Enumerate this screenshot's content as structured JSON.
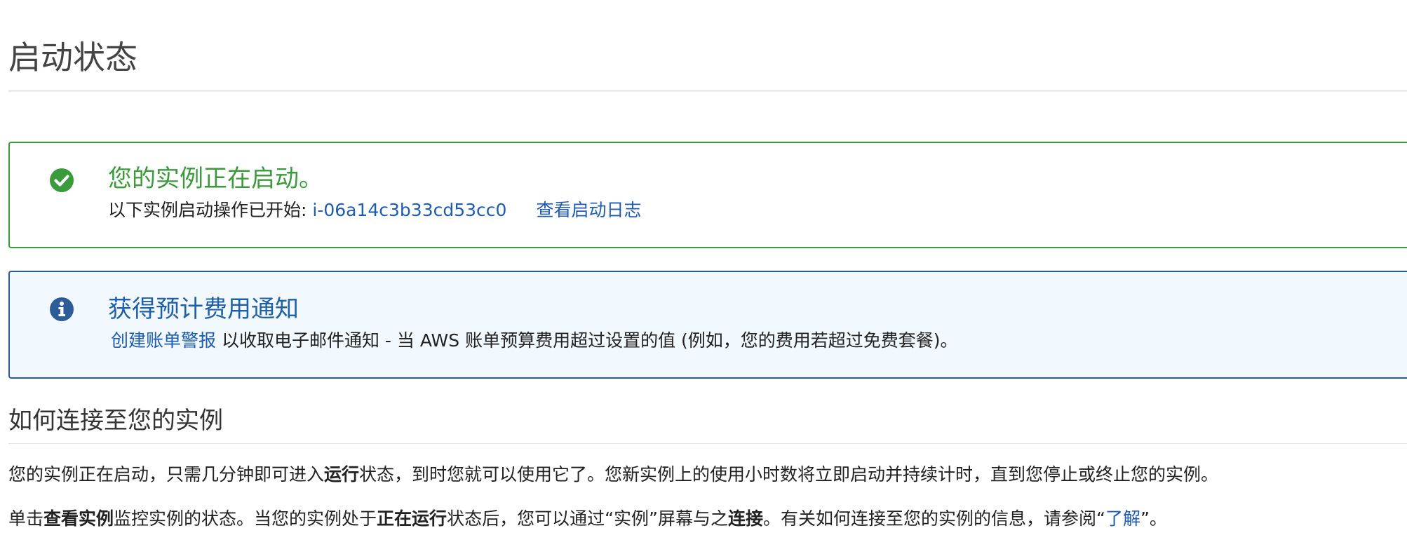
{
  "page": {
    "title": "启动状态"
  },
  "success_alert": {
    "heading": "您的实例正在启动。",
    "prefix": "以下实例启动操作已开始: ",
    "instance_id": "i-06a14c3b33cd53cc0",
    "view_log_link": "查看启动日志",
    "icon": "check-circle-icon",
    "color": "#3b9a3b"
  },
  "info_alert": {
    "heading": "获得预计费用通知",
    "billing_alert_link": "创建账单警报",
    "text": " 以收取电子邮件通知 - 当 AWS 账单预算费用超过设置的值 (例如，您的费用若超过免费套餐)。",
    "icon": "info-circle-icon",
    "color": "#2e5c99"
  },
  "connect_section": {
    "heading": "如何连接至您的实例",
    "para1": {
      "part1": "您的实例正在启动，只需几分钟即可进入",
      "bold1": "运行",
      "part2": "状态，到时您就可以使用它了。您新实例上的使用小时数将立即启动并持续计时，直到您停止或终止您的实例。"
    },
    "para2": {
      "part1": "单击",
      "bold1": "查看实例",
      "part2": "监控实例的状态。当您的实例处于",
      "bold2": "正在运行",
      "part3": "状态后，您可以通过“实例”屏幕与之",
      "bold3": "连接",
      "part4": "。有关如何连接至您的实例的信息，请参阅“",
      "learn_link": "了解",
      "part5": "”。"
    }
  }
}
